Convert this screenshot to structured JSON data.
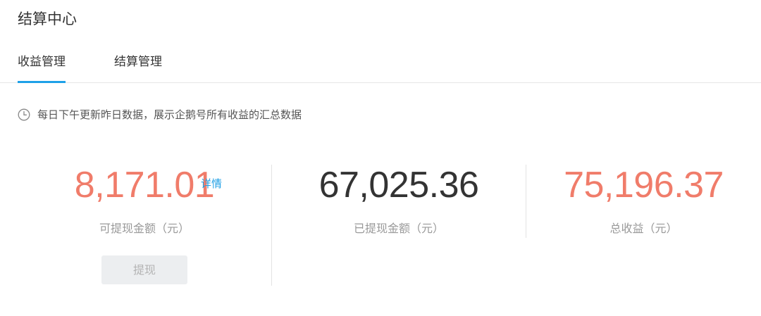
{
  "page": {
    "title": "结算中心"
  },
  "tabs": [
    {
      "label": "收益管理",
      "active": true
    },
    {
      "label": "结算管理",
      "active": false
    }
  ],
  "notice": {
    "icon": "clock-icon",
    "text": "每日下午更新昨日数据，展示企鹅号所有收益的汇总数据"
  },
  "stats": [
    {
      "amount": "8,171.01",
      "label": "可提现金额（元）",
      "link": "详情",
      "color": "#f07c6a"
    },
    {
      "amount": "67,025.36",
      "label": "已提现金额（元）",
      "color": "#333333"
    },
    {
      "amount": "75,196.37",
      "label": "总收益（元）",
      "color": "#f07c6a"
    }
  ],
  "actions": {
    "withdraw_label": "提现"
  },
  "colors": {
    "accent": "#1ea1e8",
    "amount_highlight": "#f07c6a",
    "link": "#1e9fe5",
    "divider": "#e6e6e6"
  }
}
